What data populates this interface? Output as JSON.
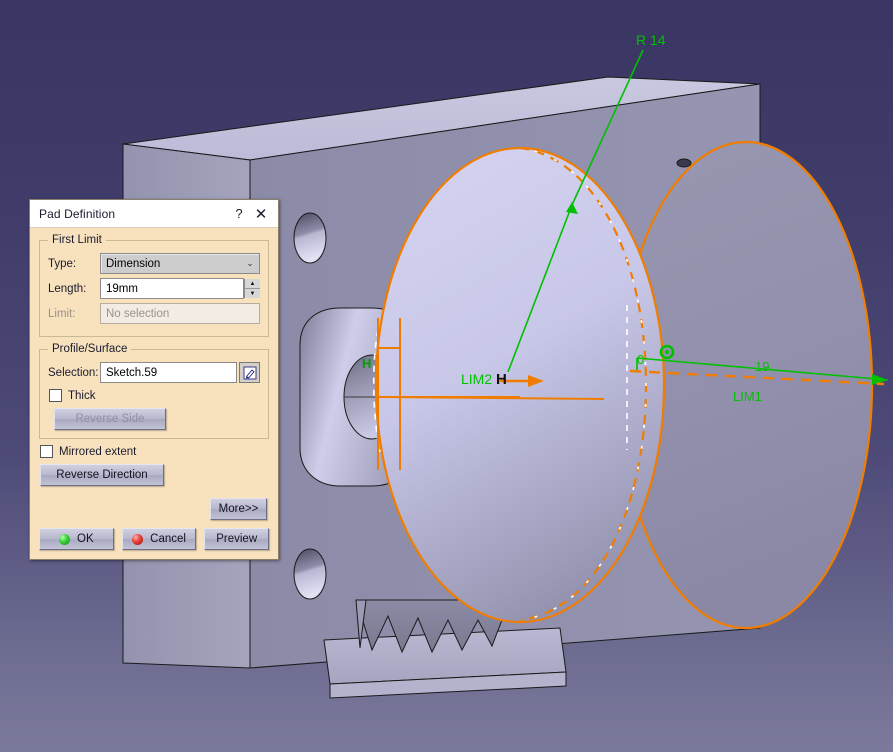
{
  "app": {
    "viewport_name": "cad-3d-viewport",
    "background_top": "#3a3663",
    "background_bottom": "#7b7a9c",
    "part_color": "#8b8aa6",
    "highlight_color": "#f07d00",
    "annotation_color": "#00c000"
  },
  "dialog": {
    "title": "Pad Definition",
    "help_label": "?",
    "close_label": "✕",
    "first_limit": {
      "legend": "First Limit",
      "type_label": "Type:",
      "type_value": "Dimension",
      "type_chevron": "⌄",
      "length_label": "Length:",
      "length_value": "19mm",
      "spin_up": "▲",
      "spin_down": "▼",
      "limit_label": "Limit:",
      "limit_placeholder": "No selection"
    },
    "profile_surface": {
      "legend": "Profile/Surface",
      "selection_label": "Selection:",
      "selection_value": "Sketch.59",
      "edit_icon_name": "sketch-edit-icon",
      "thick_label": "Thick",
      "reverse_side_label": "Reverse Side"
    },
    "mirrored_extent_label": "Mirrored extent",
    "reverse_direction_label": "Reverse Direction",
    "more_label": "More>>",
    "ok_label": "OK",
    "cancel_label": "Cancel",
    "preview_label": "Preview"
  },
  "annotations": {
    "radius": "R 14",
    "limit2": "LIM2",
    "limit1": "LIM1",
    "dim_zero": "0",
    "dim_nineteen": "19",
    "h_marker_left": "H",
    "h_marker_lim2": "H"
  }
}
